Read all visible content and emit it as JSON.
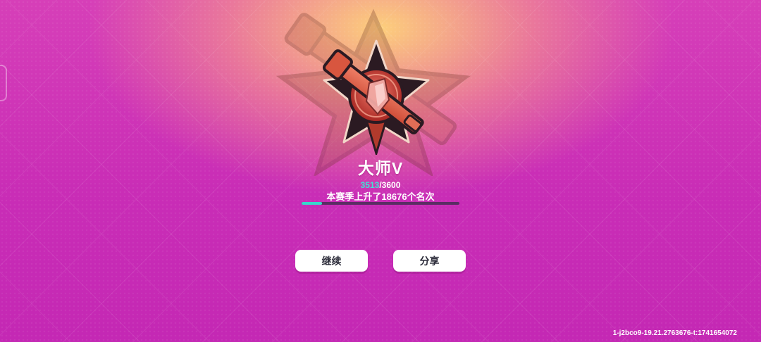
{
  "rank": {
    "title": "大师V",
    "progress_current": "3513",
    "progress_separator": "/",
    "progress_max": "3600",
    "progress_fraction": 0.13,
    "season_text": "本赛季上升了18676个名次"
  },
  "buttons": {
    "continue_label": "继续",
    "share_label": "分享"
  },
  "footer": {
    "build_id": "1-j2bco9-19.21.2763676-t:1741654072"
  },
  "colors": {
    "progress_current": "#41e2d4",
    "progress_fill": "#39d6cc",
    "emblem_red": "#d8443a",
    "emblem_dark": "#2b1a22"
  },
  "icons": {
    "emblem": "rank-emblem-icon",
    "background_emblem": "rank-emblem-watermark-icon"
  }
}
